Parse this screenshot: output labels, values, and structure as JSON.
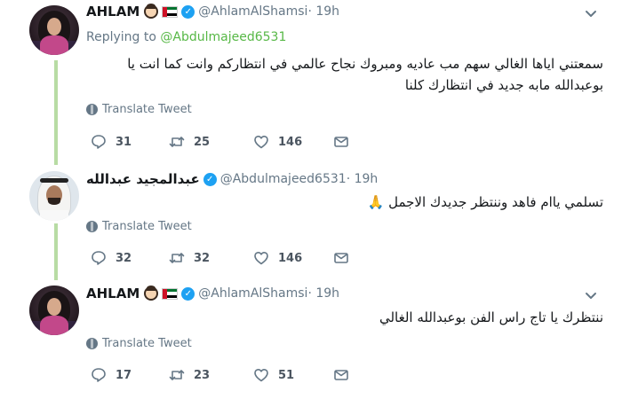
{
  "tweets": [
    {
      "author_name": "AHLAM",
      "handle": "@AhlamAlShamsi",
      "time": " · 19h",
      "replying_label": "Replying to ",
      "replying_to": "@Abdulmajeed6531",
      "text": "سمعتني اياها الغالي سهم مب عاديه ومبروك نجاح عالمي في انتظاركم وانت كما انت يا بوعبدالله مابه جديد في انتظارك كلنا",
      "translate": "Translate Tweet",
      "replies": "31",
      "retweets": "25",
      "likes": "146"
    },
    {
      "author_name": "عبدالمجيد عبدالله",
      "handle": "@Abdulmajeed6531",
      "time": " · 19h",
      "text": "تسلمي ياام فاهد وننتظر جديدك الاجمل",
      "emoji": "🙏",
      "translate": "Translate Tweet",
      "replies": "32",
      "retweets": "32",
      "likes": "146"
    },
    {
      "author_name": "AHLAM",
      "handle": "@AhlamAlShamsi",
      "time": " · 19h",
      "text": "ننتظرك يا تاج راس الفن بوعبدالله الغالي",
      "translate": "Translate Tweet",
      "replies": "17",
      "retweets": "23",
      "likes": "51"
    }
  ],
  "colors": {
    "thread_line": "#b8dca4",
    "mention": "#57b846",
    "verified": "#1da1f2",
    "muted": "#657786"
  },
  "icons": [
    "reply-icon",
    "retweet-icon",
    "like-icon",
    "message-icon",
    "verified-icon",
    "globe-icon",
    "chevron-down-icon",
    "uae-flag-icon",
    "woman-emoji-icon"
  ]
}
